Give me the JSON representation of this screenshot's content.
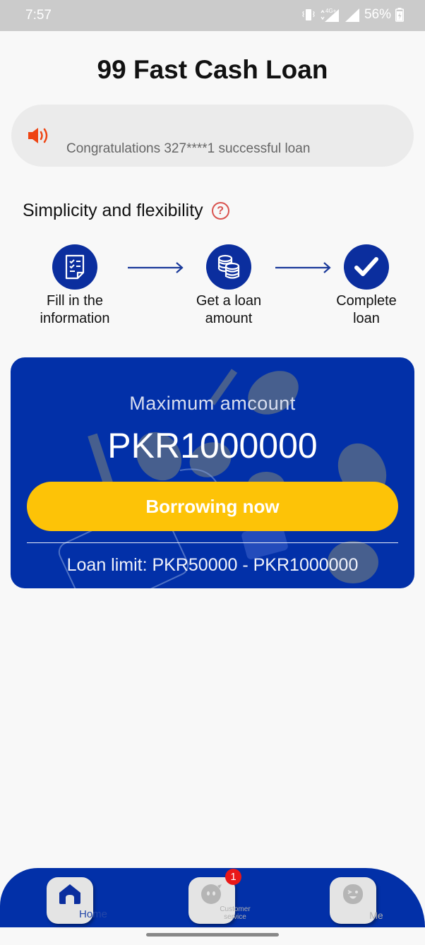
{
  "status_bar": {
    "time": "7:57",
    "network": "4G+",
    "battery": "56%",
    "icons": [
      "vibrate-icon",
      "data-arrows-icon",
      "signal-icon",
      "signal-icon",
      "battery-charging-icon"
    ]
  },
  "header": {
    "title": "99 Fast Cash Loan"
  },
  "notice": {
    "icon": "speaker-icon",
    "message": "Congratulations 327****1 successful loan"
  },
  "process": {
    "title": "Simplicity and flexibility",
    "help_icon": "question-circle-icon",
    "steps": [
      {
        "icon": "checklist-document-icon",
        "line1": "Fill in the",
        "line2": "information"
      },
      {
        "icon": "coins-stack-icon",
        "line1": "Get a loan",
        "line2": "amount"
      },
      {
        "icon": "checkmark-icon",
        "line1": "Complete",
        "line2": "loan"
      }
    ]
  },
  "loan_card": {
    "max_label": "Maximum amcount",
    "max_amount": "PKR1000000",
    "borrow_button": "Borrowing now",
    "limit_text": "Loan limit: PKR50000 - PKR1000000"
  },
  "tab_bar": {
    "tabs": [
      {
        "label": "Home",
        "icon": "home-icon",
        "active": true
      },
      {
        "label": "Customer service",
        "icon": "chat-bot-icon",
        "active": false,
        "badge": "1"
      },
      {
        "label": "Me",
        "icon": "profile-face-icon",
        "active": false
      }
    ]
  },
  "colors": {
    "primary_blue": "#0230a8",
    "button_yellow": "#fdc307",
    "badge_red": "#e91818",
    "speaker_orange": "#ee4412"
  }
}
